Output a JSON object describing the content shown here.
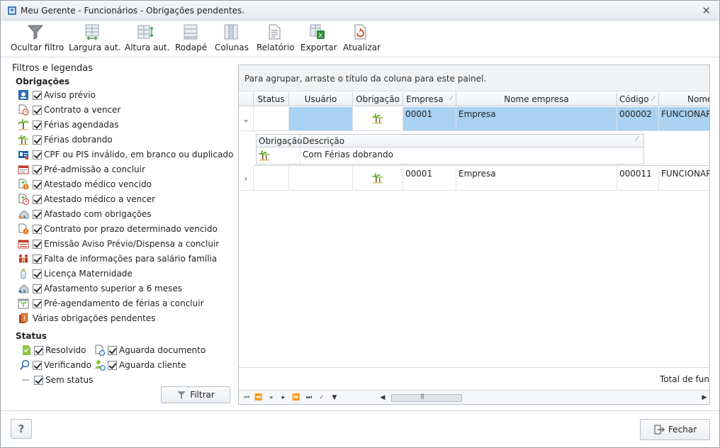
{
  "window": {
    "title": "Meu Gerente - Funcionários - Obrigações pendentes.",
    "close_glyph": "✕"
  },
  "toolbar": {
    "buttons": [
      {
        "label": "Ocultar filtro",
        "icon": "funnel-icon"
      },
      {
        "label": "Largura aut.",
        "icon": "auto-width-icon"
      },
      {
        "label": "Altura aut.",
        "icon": "auto-height-icon"
      },
      {
        "label": "Rodapé",
        "icon": "footer-icon"
      },
      {
        "label": "Colunas",
        "icon": "columns-icon"
      },
      {
        "label": "Relatório",
        "icon": "report-icon"
      },
      {
        "label": "Exportar",
        "icon": "export-excel-icon"
      },
      {
        "label": "Atualizar",
        "icon": "refresh-icon"
      }
    ]
  },
  "filters": {
    "title": "Filtros e legendas",
    "obligations_header": "Obrigações",
    "obligations": [
      {
        "label": "Aviso prévio",
        "checked": true,
        "icon": "notice-icon"
      },
      {
        "label": "Contrato a vencer",
        "checked": true,
        "icon": "contract-clock-icon"
      },
      {
        "label": "Férias agendadas",
        "checked": true,
        "icon": "palm-tree-icon"
      },
      {
        "label": "Férias dobrando",
        "checked": true,
        "icon": "palm-tree-double-icon"
      },
      {
        "label": "CPF ou PIS inválido, em branco ou duplicado",
        "checked": true,
        "icon": "id-card-icon"
      },
      {
        "label": "Pré-admissão a concluir",
        "checked": true,
        "icon": "pre-admission-icon"
      },
      {
        "label": "Atestado médico vencido",
        "checked": true,
        "icon": "medical-expired-icon"
      },
      {
        "label": "Atestado médico a vencer",
        "checked": true,
        "icon": "medical-clock-icon"
      },
      {
        "label": "Afastado com obrigações",
        "checked": true,
        "icon": "house-leave-icon"
      },
      {
        "label": "Contrato por prazo determinado vencido",
        "checked": true,
        "icon": "contract-expired-icon"
      },
      {
        "label": "Emissão Aviso Prévio/Dispensa a concluir",
        "checked": true,
        "icon": "notice-issue-icon"
      },
      {
        "label": "Falta de informações para salário família",
        "checked": true,
        "icon": "family-icon"
      },
      {
        "label": "Licença Maternidade",
        "checked": true,
        "icon": "bottle-icon"
      },
      {
        "label": "Afastamento superior a 6 meses",
        "checked": true,
        "icon": "house-long-leave-icon"
      },
      {
        "label": "Pré-agendamento de férias a concluir",
        "checked": true,
        "icon": "vacation-schedule-icon"
      }
    ],
    "multiple_label": "Várias obrigações pendentes",
    "status_header": "Status",
    "status": [
      {
        "label": "Resolvido",
        "checked": true,
        "icon": "resolved-icon"
      },
      {
        "label": "Aguarda documento",
        "checked": true,
        "icon": "waiting-document-icon"
      },
      {
        "label": "Verificando",
        "checked": true,
        "icon": "verifying-icon"
      },
      {
        "label": "Aguarda cliente",
        "checked": true,
        "icon": "waiting-client-icon"
      },
      {
        "label": "Sem status",
        "checked": true,
        "icon": "no-status-icon"
      }
    ],
    "filter_button": "Filtrar"
  },
  "grid": {
    "group_hint": "Para agrupar, arraste o título da coluna para este painel.",
    "columns": [
      "Status",
      "Usuário",
      "Obrigação",
      "Empresa",
      "Nome empresa",
      "Código",
      "Nome"
    ],
    "rows": [
      {
        "expanded": true,
        "status": "",
        "usuario": "",
        "obrigacao_icon": "palm-tree-double-icon",
        "empresa": "00001",
        "nome_empresa": "Empresa",
        "codigo": "000002",
        "nome": "FUNCIONARI"
      },
      {
        "expanded": false,
        "status": "",
        "usuario": "",
        "obrigacao_icon": "palm-tree-double-icon",
        "empresa": "00001",
        "nome_empresa": "Empresa",
        "codigo": "000011",
        "nome": "FUNCIONARI"
      }
    ],
    "detail": {
      "columns": [
        "Obrigação",
        "Descrição"
      ],
      "rows": [
        {
          "obrigacao_icon": "palm-tree-double-icon",
          "descricao": "Com Férias dobrando"
        }
      ]
    },
    "footer_total": "Total de fun"
  },
  "footer": {
    "help_label": "?",
    "close_label": "Fechar"
  },
  "colors": {
    "selection": "#a9d1f2",
    "border": "#b9c0c8",
    "header_bg": "#eef1f4"
  }
}
